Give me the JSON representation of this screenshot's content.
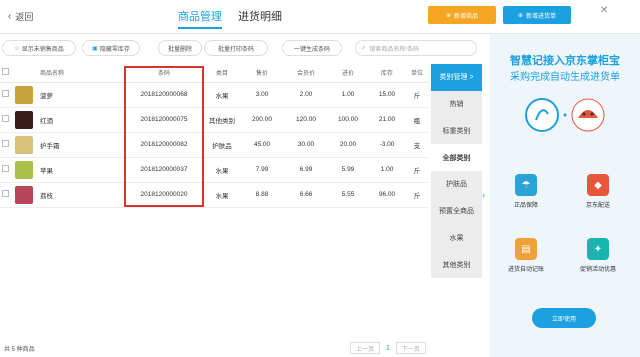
{
  "header": {
    "back_label": "返回",
    "tabs": [
      {
        "label": "商品管理",
        "active": true
      },
      {
        "label": "进货明细",
        "active": false
      }
    ],
    "btn_left_label": "新增商品",
    "btn_right_label": "新增进货单"
  },
  "toolbar": {
    "show_unsold_label": "显示未销售商品",
    "hide_zero_stock_label": "隐藏零库存",
    "batch_delete_label": "批量删除",
    "batch_print_label": "批量打印条码",
    "gen_barcode_label": "一键生成条码",
    "search_placeholder": "搜索商品名称/条码"
  },
  "table": {
    "columns": [
      "商品名称",
      "条码",
      "类目",
      "售价",
      "会员价",
      "进价",
      "库存",
      "单位"
    ],
    "rows": [
      {
        "name": "菠萝",
        "barcode": "2018120000068",
        "category": "水果",
        "price": "3.00",
        "member_price": "2.00",
        "cost": "1.00",
        "stock": "15.00",
        "unit": "斤",
        "thumb_color": "#c9a43a"
      },
      {
        "name": "红酒",
        "barcode": "2018120000075",
        "category": "其他类别",
        "price": "200.00",
        "member_price": "120.00",
        "cost": "100.00",
        "stock": "21.00",
        "unit": "瓶",
        "thumb_color": "#3a1d1d"
      },
      {
        "name": "护手霜",
        "barcode": "2018120000082",
        "category": "护肤品",
        "price": "45.00",
        "member_price": "30.00",
        "cost": "20.00",
        "stock": "-3.00",
        "unit": "支",
        "thumb_color": "#d8c27a"
      },
      {
        "name": "苹果",
        "barcode": "2018120000037",
        "category": "水果",
        "price": "7.99",
        "member_price": "6.99",
        "cost": "5.99",
        "stock": "1.00",
        "unit": "斤",
        "thumb_color": "#a8c04a"
      },
      {
        "name": "荔枝",
        "barcode": "2018120000020",
        "category": "水果",
        "price": "8.88",
        "member_price": "6.66",
        "cost": "5.55",
        "stock": "96.00",
        "unit": "斤",
        "thumb_color": "#b8455a"
      }
    ]
  },
  "categories": {
    "header": "类别管理 >",
    "items": [
      {
        "label": "热销",
        "selected": false
      },
      {
        "label": "标重类别",
        "selected": false
      },
      {
        "label": "全部类别",
        "selected": true
      },
      {
        "label": "护肤品",
        "selected": false
      },
      {
        "label": "预置全商品",
        "selected": false
      },
      {
        "label": "水果",
        "selected": false
      },
      {
        "label": "其他类别",
        "selected": false
      }
    ]
  },
  "footer": {
    "count_label": "共 5 种商品",
    "prev_label": "上一页",
    "page": "1",
    "next_label": "下一页"
  },
  "promo": {
    "title": "智慧记接入京东掌柜宝",
    "subtitle": "采购完成自动生成进货单",
    "features": [
      {
        "label": "正品保障",
        "color": "#2aa3d8"
      },
      {
        "label": "京东配送",
        "color": "#e8553b"
      },
      {
        "label": "进货自动记账",
        "color": "#f0a23a"
      },
      {
        "label": "促销活动优惠",
        "color": "#18b4b0"
      }
    ],
    "cta_label": "立即使用"
  },
  "colors": {
    "accent": "#1ba1e2",
    "highlight_border": "#d9352b",
    "orange": "#f5a623"
  }
}
